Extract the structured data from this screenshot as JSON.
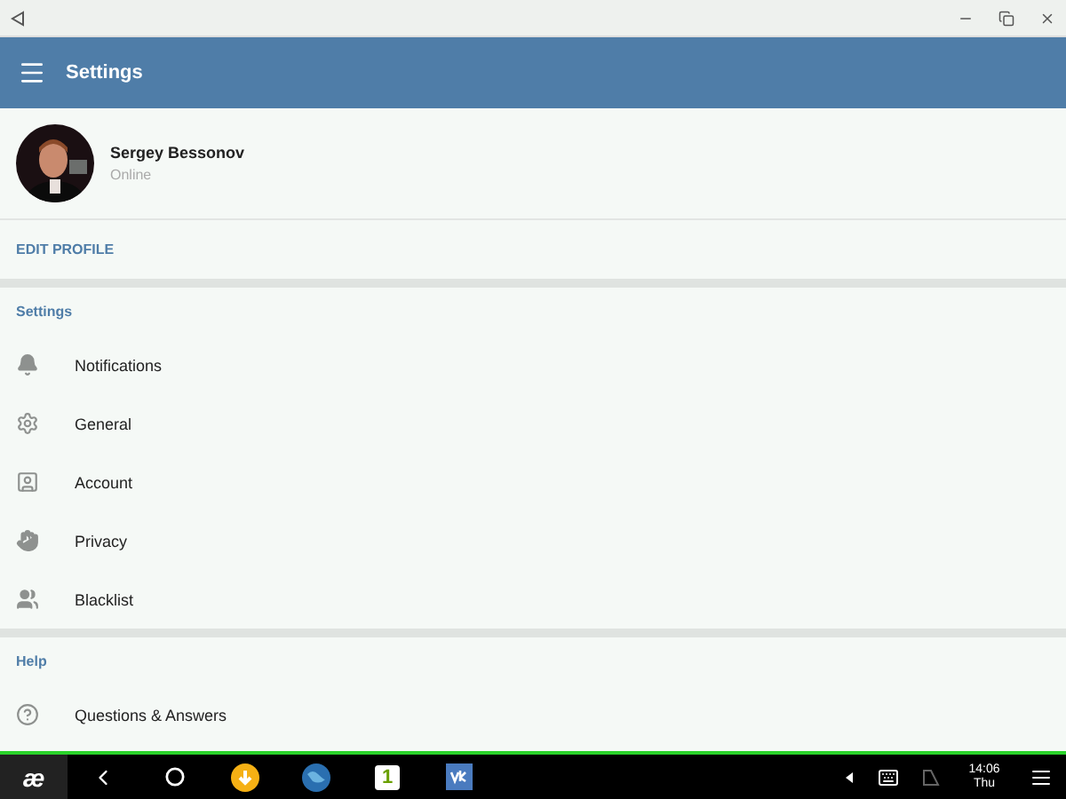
{
  "app_bar": {
    "title": "Settings"
  },
  "profile": {
    "name": "Sergey Bessonov",
    "status": "Online",
    "action": "EDIT PROFILE"
  },
  "sections": [
    {
      "header": "Settings",
      "items": [
        {
          "label": "Notifications"
        },
        {
          "label": "General"
        },
        {
          "label": "Account"
        },
        {
          "label": "Privacy"
        },
        {
          "label": "Blacklist"
        }
      ]
    },
    {
      "header": "Help",
      "items": [
        {
          "label": "Questions & Answers"
        }
      ]
    }
  ],
  "taskbar": {
    "logo": "æ",
    "app_badge": "1",
    "time": "14:06",
    "day": "Thu"
  }
}
